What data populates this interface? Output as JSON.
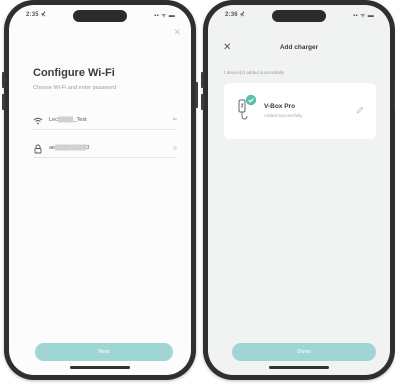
{
  "left_screen": {
    "status_time": "2:35 ⊀",
    "status_icons": "▪▪ ᯤ ▬",
    "close_label": "✕",
    "title": "Configure Wi-Fi",
    "subtitle": "Choose Wi-Fi and enter password",
    "wifi_field": {
      "icon": "wifi-icon",
      "value": "Lec▒▒▒▒_Test",
      "action_label": "⇆"
    },
    "password_field": {
      "icon": "lock-icon",
      "value": "ae▒▒▒▒▒▒▒▒3",
      "action_label": "◎"
    },
    "next_label": "Next"
  },
  "right_screen": {
    "status_time": "2:36 ⊀",
    "status_icons": "▪▪ ᯤ ▬",
    "close_label": "✕",
    "nav_title": "Add charger",
    "sub_label": "1 device(s) added successfully",
    "device": {
      "name": "V-Box Pro",
      "status": "Added successfully",
      "icon": "ev-charger-icon"
    },
    "done_label": "Done"
  },
  "colors": {
    "accent": "#9fd6d3",
    "success_badge": "#56c2a8",
    "phone_frame": "#2f2f2f",
    "screen_bg_white": "#fbfcfb",
    "screen_bg_gray": "#f1f3f2"
  }
}
